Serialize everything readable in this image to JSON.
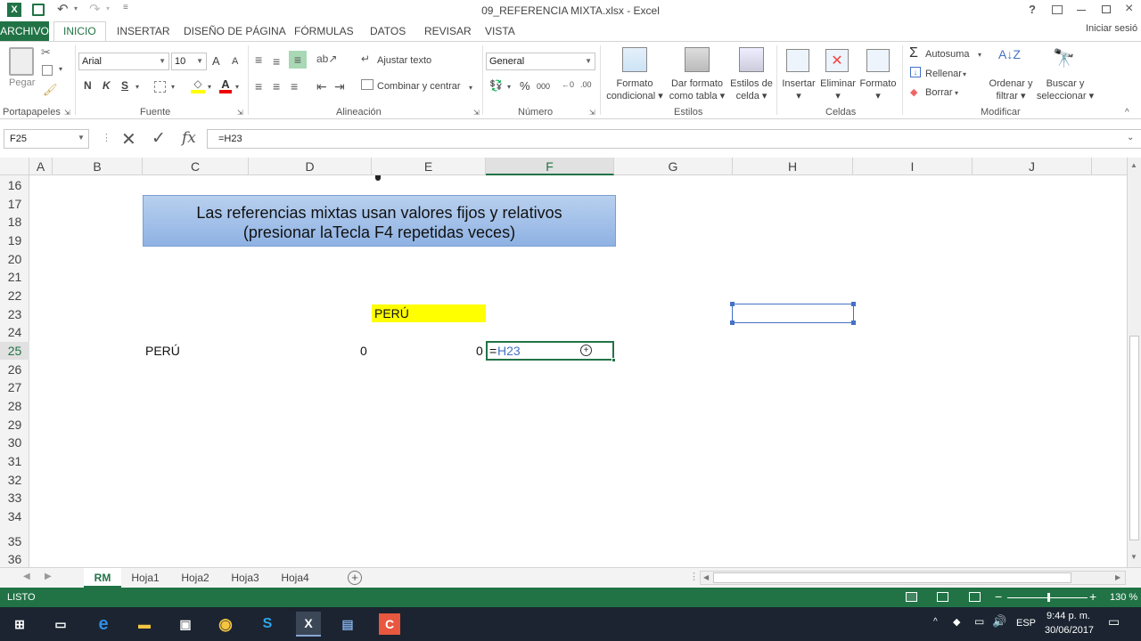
{
  "titlebar": {
    "title": "09_REFERENCIA MIXTA.xlsx - Excel",
    "help": "?",
    "signin": "Iniciar sesió"
  },
  "ribbon_tabs": [
    "ARCHIVO",
    "INICIO",
    "INSERTAR",
    "DISEÑO DE PÁGINA",
    "FÓRMULAS",
    "DATOS",
    "REVISAR",
    "VISTA"
  ],
  "ribbon": {
    "clipboard": {
      "paste": "Pegar",
      "label": "Portapapeles"
    },
    "font": {
      "name": "Arial",
      "size": "10",
      "bold": "N",
      "italic": "K",
      "underline": "S",
      "label": "Fuente",
      "grow": "A",
      "shrink": "A"
    },
    "alignment": {
      "wrap": "Ajustar texto",
      "merge": "Combinar y centrar",
      "label": "Alineación"
    },
    "number": {
      "format": "General",
      "percent": "%",
      "thousands": "000",
      "label": "Número"
    },
    "styles": {
      "conditional1": "Formato",
      "conditional2": "condicional",
      "table1": "Dar formato",
      "table2": "como tabla",
      "cell1": "Estilos de",
      "cell2": "celda",
      "label": "Estilos"
    },
    "cells": {
      "insert": "Insertar",
      "delete": "Eliminar",
      "format": "Formato",
      "label": "Celdas"
    },
    "editing": {
      "autosum": "Autosuma",
      "fill": "Rellenar",
      "clear": "Borrar",
      "sort1": "Ordenar y",
      "sort2": "filtrar",
      "find1": "Buscar y",
      "find2": "seleccionar",
      "label": "Modificar"
    }
  },
  "formula_bar": {
    "name_box": "F25",
    "formula": "=H23"
  },
  "columns": [
    "A",
    "B",
    "C",
    "D",
    "E",
    "F",
    "G",
    "H",
    "I",
    "J"
  ],
  "rows": [
    "16",
    "17",
    "18",
    "19",
    "20",
    "21",
    "22",
    "23",
    "24",
    "25",
    "26",
    "27",
    "28",
    "29",
    "30",
    "31",
    "32",
    "33",
    "34",
    "35",
    "36"
  ],
  "cells": {
    "banner_line1": "Las referencias mixtas usan valores fijos y relativos",
    "banner_line2": "(presionar laTecla F4 repetidas veces)",
    "e23": "PERÚ",
    "c25": "PERÚ",
    "d25": "0",
    "e25": "0",
    "f25_eq": "=",
    "f25_ref": "H23"
  },
  "sheets": [
    "RM",
    "Hoja1",
    "Hoja2",
    "Hoja3",
    "Hoja4"
  ],
  "status": {
    "mode": "LISTO",
    "zoom": "130 %"
  },
  "taskbar": {
    "lang": "ESP",
    "time": "9:44 p. m.",
    "date": "30/06/2017"
  },
  "colors": {
    "excel_green": "#217346",
    "banner": "#9dbde8",
    "yellow": "#ffff00",
    "ref_blue": "#4472c4"
  }
}
